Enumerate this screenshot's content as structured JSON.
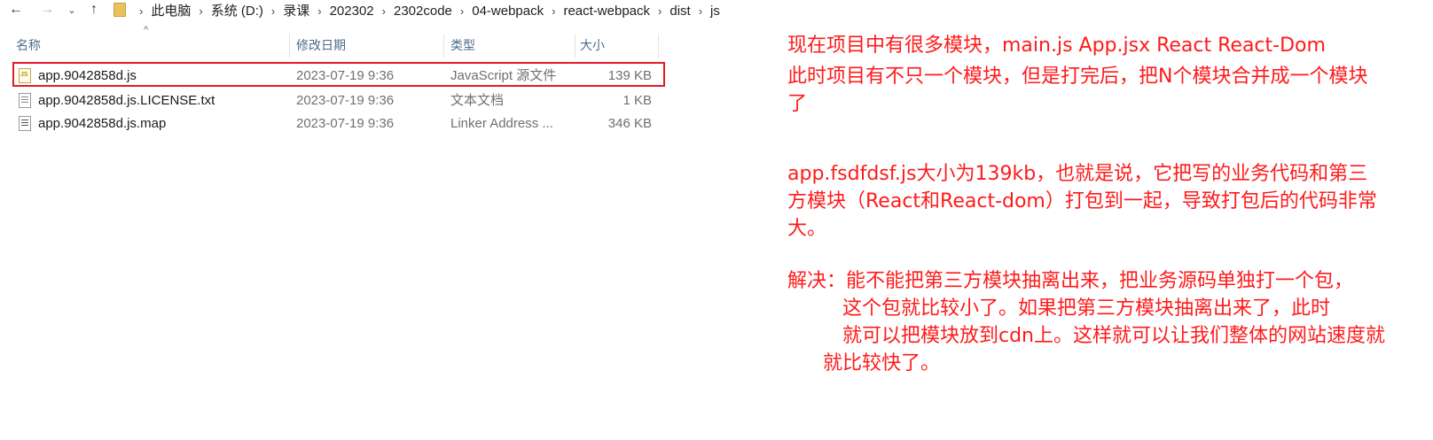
{
  "nav": {
    "back": "←",
    "forward": "→",
    "history": "⌄",
    "up": "↑",
    "breadcrumb": [
      "此电脑",
      "系统 (D:)",
      "录课",
      "202302",
      "2302code",
      "04-webpack",
      "react-webpack",
      "dist",
      "js"
    ],
    "separator": "›"
  },
  "columns": {
    "name": "名称",
    "date": "修改日期",
    "type": "类型",
    "size": "大小",
    "sort_indicator": "^"
  },
  "files": [
    {
      "name": "app.9042858d.js",
      "date": "2023-07-19 9:36",
      "type": "JavaScript 源文件",
      "size": "139 KB",
      "icon": "js-file-icon"
    },
    {
      "name": "app.9042858d.js.LICENSE.txt",
      "date": "2023-07-19 9:36",
      "type": "文本文档",
      "size": "1 KB",
      "icon": "text-file-icon"
    },
    {
      "name": "app.9042858d.js.map",
      "date": "2023-07-19 9:36",
      "type": "Linker Address ...",
      "size": "346 KB",
      "icon": "map-file-icon"
    }
  ],
  "annotations": {
    "color": "#ff1a1a",
    "highlight_color": "#e01b2a",
    "lines": [
      "现在项目中有很多模块，main.js    App.jsx   React  React-Dom",
      "此时项目有不只一个模块，但是打完后，把N个模块合并成一个模块",
      "了",
      "app.fsdfdsf.js大小为139kb，也就是说，它把写的业务代码和第三",
      "方模块（React和React-dom）打包到一起，导致打包后的代码非常",
      "大。",
      "解决：能不能把第三方模块抽离出来，把业务源码单独打一个包，",
      "这个包就比较小了。如果把第三方模块抽离出来了，此时",
      "就可以把模块放到cdn上。这样就可以让我们整体的网站速度就",
      "就比较快了。"
    ]
  }
}
